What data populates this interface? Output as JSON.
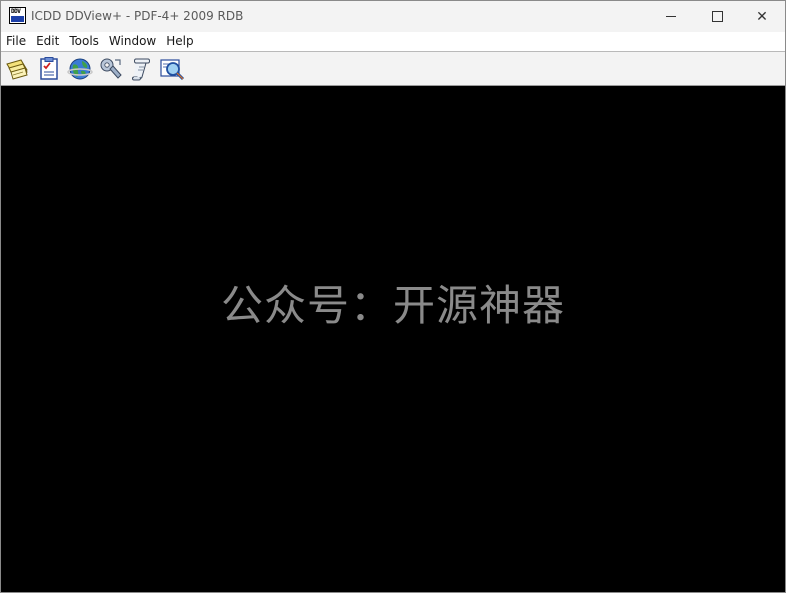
{
  "window": {
    "title": "ICDD DDView+ - PDF-4+ 2009 RDB",
    "app_icon_text": "DDV",
    "controls": {
      "minimize": "minimize",
      "maximize": "maximize",
      "close": "✕"
    }
  },
  "menu": {
    "items": [
      "File",
      "Edit",
      "Tools",
      "Window",
      "Help"
    ]
  },
  "toolbar": {
    "icons": [
      "notes-icon",
      "checklist-icon",
      "globe-icon",
      "wrench-icon",
      "scroll-icon",
      "search-icon"
    ]
  },
  "main": {
    "background": "#000000",
    "watermark_text": "公众号：开源神器"
  },
  "colors": {
    "accent": "#1c3fa8",
    "watermark": "#8a8a8a",
    "titlebar": "#f3f3f3"
  }
}
